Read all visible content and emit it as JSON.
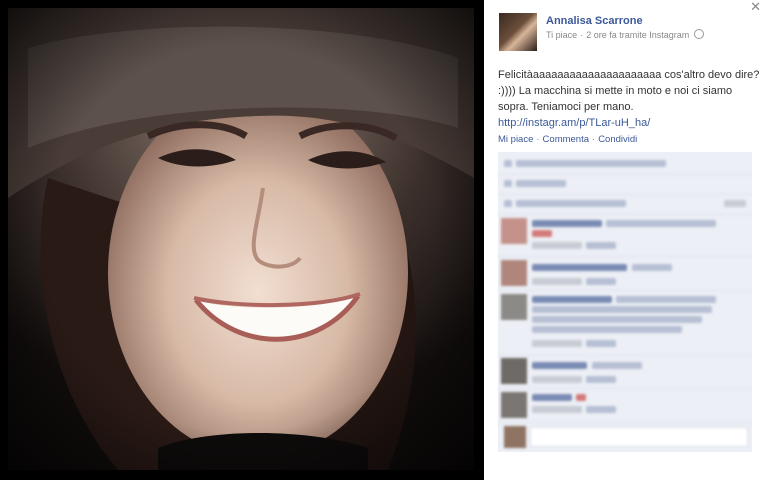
{
  "photo": {
    "alt_subject": ""
  },
  "post": {
    "author": "Annalisa Scarrone",
    "meta_like": "Ti piace",
    "meta_time": "2 ore fa tramite Instagram",
    "text_line": "Felicitàaaaaaaaaaaaaaaaaaaaaa cos'altro devo dire? :)))) La macchina si mette in moto e noi ci siamo sopra. Teniamoci per mano.",
    "link": "http://instagr.am/p/TLar-uH_ha/"
  },
  "actions": {
    "like": "Mi piace",
    "comment": "Commenta",
    "share": "Condividi"
  },
  "icons": {
    "close": "close-icon",
    "meta_globe": "globe-icon"
  },
  "colors": {
    "link": "#3b5998",
    "comments_bg": "#eceff5"
  }
}
